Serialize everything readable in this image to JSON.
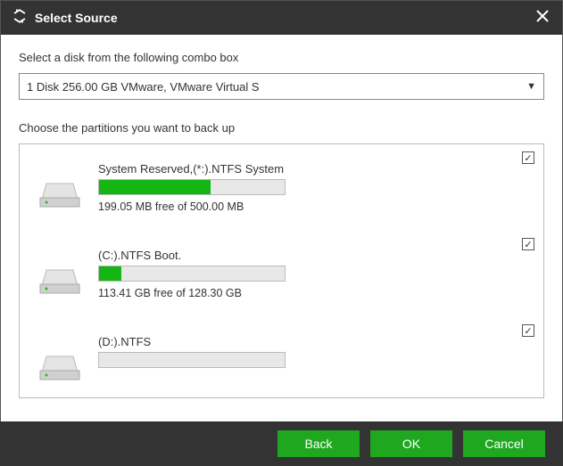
{
  "titlebar": {
    "title": "Select Source"
  },
  "instructions": {
    "disk_label": "Select a disk from the following combo box",
    "part_label": "Choose the partitions you want to back up"
  },
  "combo": {
    "selected": "1 Disk 256.00 GB VMware,  VMware Virtual S"
  },
  "partitions": [
    {
      "name": "System Reserved,(*:).NTFS System",
      "free": "199.05 MB free of 500.00 MB",
      "fill_pct": 60,
      "checked": true
    },
    {
      "name": "(C:).NTFS Boot.",
      "free": "113.41 GB free of 128.30 GB",
      "fill_pct": 12,
      "checked": true
    },
    {
      "name": "(D:).NTFS",
      "free": "",
      "fill_pct": 0,
      "checked": true
    }
  ],
  "buttons": {
    "back": "Back",
    "ok": "OK",
    "cancel": "Cancel"
  },
  "colors": {
    "accent": "#1fa81f",
    "titlebar": "#333333",
    "bar_fill": "#13b613"
  }
}
